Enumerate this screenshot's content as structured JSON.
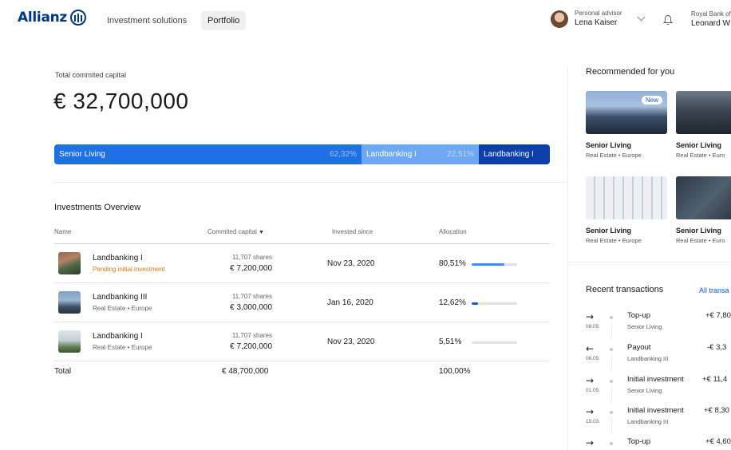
{
  "brand": {
    "name": "Allianz"
  },
  "nav": {
    "links": [
      "Investment solutions",
      "Portfolio"
    ],
    "active": "Portfolio"
  },
  "advisor": {
    "label": "Personal advisor",
    "name": "Lena Kaiser"
  },
  "account": {
    "bank": "Royal Bank of",
    "user": "Leonard W"
  },
  "portfolio": {
    "capital_label": "Total commited capital",
    "capital_value": "€ 32,700,000",
    "allocation_segments": [
      {
        "name": "Senior Living",
        "percent": "62,32%",
        "color": "#1f6fe6"
      },
      {
        "name": "Landbanking I",
        "percent": "22,51%",
        "color": "#6ea8f2"
      },
      {
        "name": "Landbanking I",
        "percent": "",
        "color": "#0c3fa8"
      }
    ]
  },
  "overview": {
    "title": "Investments Overview",
    "headers": {
      "name": "Name",
      "capital": "Commited capital",
      "since": "Invested since",
      "allocation": "Allocation"
    },
    "rows": [
      {
        "name": "Landbanking I",
        "sub": "Pending initial investment",
        "pending": true,
        "shares": "11,707 shares",
        "amount": "€ 7,200,000",
        "since": "Nov 23, 2020",
        "allocation": "80,51%",
        "fill": 0.72,
        "fill_color": "#4a86e8"
      },
      {
        "name": "Landbanking III",
        "sub": "Real Estate • Europe",
        "pending": false,
        "shares": "11,707 shares",
        "amount": "€ 3,000,000",
        "since": "Jan 16, 2020",
        "allocation": "12,62%",
        "fill": 0.14,
        "fill_color": "#1a55d6"
      },
      {
        "name": "Landbanking I",
        "sub": "Real Estate • Europe",
        "pending": false,
        "shares": "11,707 shares",
        "amount": "€ 7,200,000",
        "since": "Nov 23, 2020",
        "allocation": "5,51%",
        "fill": 0.0,
        "fill_color": "#1a55d6"
      }
    ],
    "total": {
      "label": "Total",
      "amount": "€ 48,700,000",
      "allocation": "100,00%"
    }
  },
  "recommended": {
    "title": "Recommended for you",
    "badge": "New",
    "cards": [
      {
        "title": "Senior Living",
        "sub": "Real Estate • Europe"
      },
      {
        "title": "Senior Living",
        "sub": "Real Estate • Euro"
      },
      {
        "title": "Senior Living",
        "sub": "Real Estate • Europe"
      },
      {
        "title": "Senior Living",
        "sub": "Real Estate • Euro"
      }
    ]
  },
  "transactions": {
    "title": "Recent transactions",
    "all_link": "All transa",
    "items": [
      {
        "direction": "in",
        "arrow": "→",
        "date": "08.05",
        "type": "Top-up",
        "fund": "Senior Living",
        "amount": "+€ 7,80"
      },
      {
        "direction": "out",
        "arrow": "←",
        "date": "06.05",
        "type": "Payout",
        "fund": "Landbanking III",
        "amount": "-€ 3,3"
      },
      {
        "direction": "in",
        "arrow": "→",
        "date": "01.05",
        "type": "Initial investment",
        "fund": "Senior Living",
        "amount": "+€ 11,4"
      },
      {
        "direction": "in",
        "arrow": "→",
        "date": "15.03",
        "type": "Initial investment",
        "fund": "Landbanking III",
        "amount": "+€ 8,30"
      },
      {
        "direction": "in",
        "arrow": "→",
        "date": "",
        "type": "Top-up",
        "fund": "",
        "amount": "+€ 4,60"
      }
    ]
  },
  "colors": {
    "brand": "#003781",
    "accent": "#1a55d6",
    "pending": "#e07b12"
  }
}
